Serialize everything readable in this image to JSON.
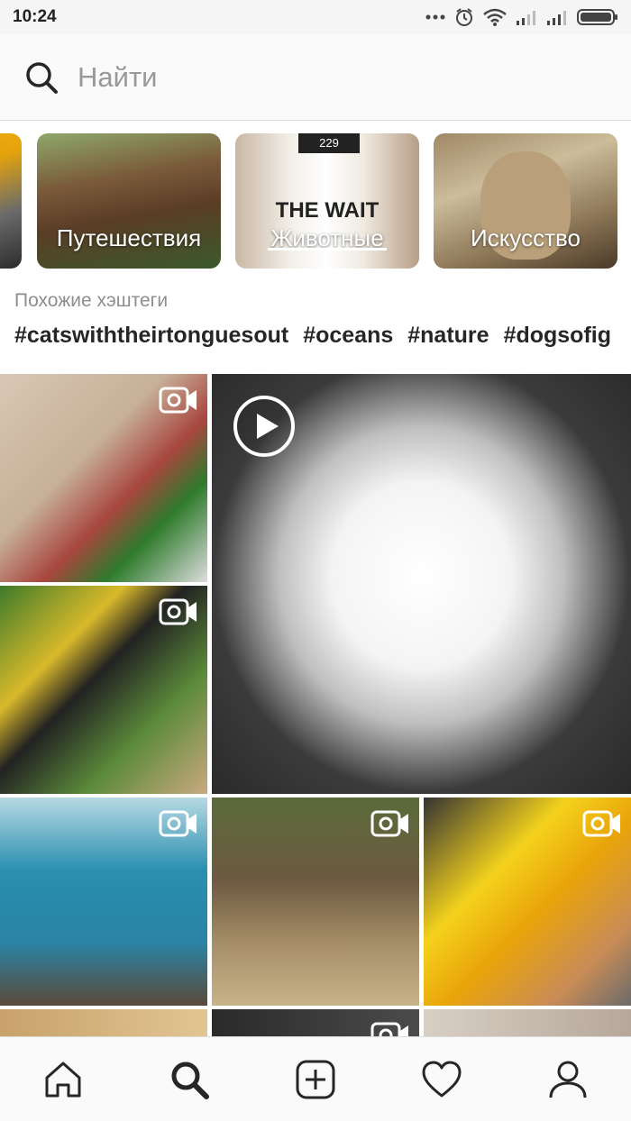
{
  "status_bar": {
    "time": "10:24"
  },
  "search": {
    "placeholder": "Найти"
  },
  "topics": [
    {
      "label": ""
    },
    {
      "label": "Путешествия"
    },
    {
      "label": "Животные",
      "overlay_text": "THE WAIT",
      "badge": "229"
    },
    {
      "label": "Искусство"
    }
  ],
  "related": {
    "label": "Похожие хэштеги",
    "hashtags": [
      "#catswiththeirtonguesout",
      "#oceans",
      "#nature",
      "#dogsofig"
    ]
  },
  "grid": {
    "items": [
      {
        "type": "video",
        "icon": "video-camera-icon"
      },
      {
        "type": "video",
        "icon": "video-camera-icon"
      },
      {
        "type": "video",
        "icon": "play-circle-icon"
      },
      {
        "type": "video",
        "icon": "video-camera-icon"
      },
      {
        "type": "video",
        "icon": "video-camera-icon"
      },
      {
        "type": "video",
        "icon": "video-camera-icon"
      },
      {
        "type": "photo"
      },
      {
        "type": "video",
        "icon": "video-camera-icon"
      },
      {
        "type": "photo"
      }
    ]
  },
  "bottom_nav": {
    "items": [
      "home-icon",
      "search-icon",
      "add-post-icon",
      "heart-icon",
      "profile-icon"
    ],
    "active": "search-icon"
  }
}
